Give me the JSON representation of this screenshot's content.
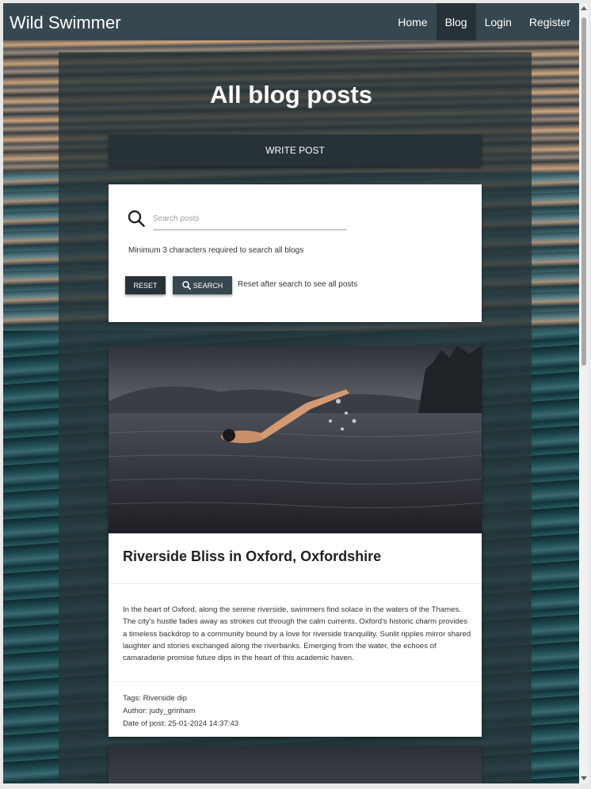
{
  "navbar": {
    "brand": "Wild Swimmer",
    "items": [
      {
        "label": "Home",
        "active": false
      },
      {
        "label": "Blog",
        "active": true
      },
      {
        "label": "Login",
        "active": false
      },
      {
        "label": "Register",
        "active": false
      }
    ]
  },
  "page": {
    "title": "All blog posts",
    "write_button": "WRITE POST"
  },
  "search": {
    "placeholder": "Search posts",
    "value": "",
    "hint": "Minimum 3 characters required to search all blogs",
    "reset_label": "RESET",
    "search_label": "SEARCH",
    "reset_note": "Reset after search to see all posts",
    "icon": "search-icon"
  },
  "posts": [
    {
      "title": "Riverside Bliss in Oxford, Oxfordshire",
      "body": "In the heart of Oxford, along the serene riverside, swimmers find solace in the waters of the Thames. The city's hustle fades away as strokes cut through the calm currents. Oxford's historic charm provides a timeless backdrop to a community bound by a love for riverside tranquility. Sunlit ripples mirror shared laughter and stories exchanged along the riverbanks. Emerging from the water, the echoes of camaraderie promise future dips in the heart of this academic haven.",
      "tags": "Tags: Riverside dip",
      "author": "Author: judy_grinham",
      "date": "Date of post: 25-01-2024 14:37:43"
    }
  ],
  "colors": {
    "navbar": "#37474f",
    "navbar_active": "#263238",
    "button_dark": "#263238",
    "button_search": "#37474f"
  }
}
